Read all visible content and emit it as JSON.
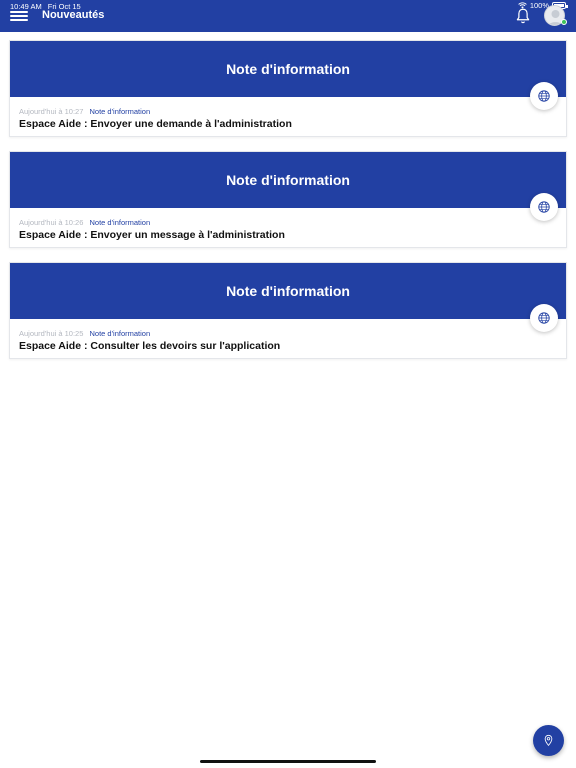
{
  "status_bar": {
    "time": "10:49 AM",
    "date": "Fri Oct 15",
    "battery": "100%"
  },
  "header": {
    "title": "Nouveautés",
    "icons": {
      "menu": "hamburger-menu-icon",
      "notifications": "bell-icon",
      "profile": "avatar"
    }
  },
  "colors": {
    "primary": "#2240a3",
    "online": "#3ec35a",
    "muted_text": "#b4b8c0",
    "title_text": "#111111"
  },
  "cards": [
    {
      "banner": "Note d'information",
      "time": "Aujourd'hui à 10:27",
      "category": "Note d'information",
      "title": "Espace Aide : Envoyer une demande à l'administration"
    },
    {
      "banner": "Note d'information",
      "time": "Aujourd'hui à 10:26",
      "category": "Note d'information",
      "title": "Espace Aide : Envoyer un message à l'administration"
    },
    {
      "banner": "Note d'information",
      "time": "Aujourd'hui à 10:25",
      "category": "Note d'information",
      "title": "Espace Aide : Consulter les devoirs sur l'application"
    }
  ],
  "fab": {
    "icon": "map-pin-icon"
  }
}
